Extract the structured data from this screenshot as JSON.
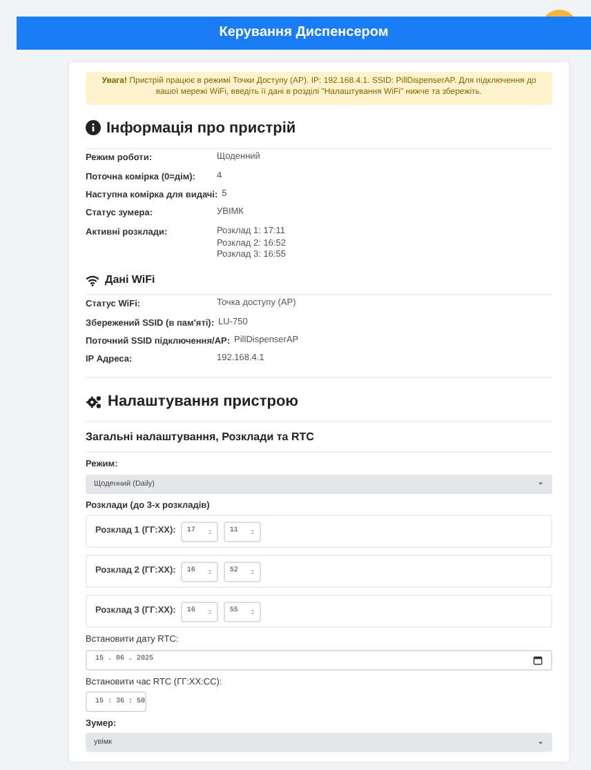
{
  "header": {
    "title": "Керування Диспенсером"
  },
  "alert": {
    "text": "**Увага!** Пристрій працює в режимі Точки Доступу (AP). IP: 192.168.4.1. SSID: PillDispenserAP. Для підключення до вашої мережі WiFi, введіть її дані в розділі \"Налаштування WiFi\" нижче та збережіть."
  },
  "info": {
    "title": "Інформація про пристрій",
    "rows": [
      {
        "label": "Режим роботи:",
        "lines": [
          "Щоденний"
        ]
      },
      {
        "label": "Поточна комірка (0=дім):",
        "lines": [
          "4"
        ]
      },
      {
        "label": "Наступна комірка для видачі:",
        "lines": [
          "5"
        ]
      },
      {
        "label": "Статус зумера:",
        "lines": [
          "УВІМК"
        ]
      },
      {
        "label": "Активні розклади:",
        "lines": [
          "Розклад 1: 17:11",
          "Розклад 2: 16:52",
          "Розклад 3: 16:55"
        ]
      }
    ]
  },
  "wifi": {
    "title": "Дані WiFi",
    "rows": [
      {
        "label": "Статус WiFi:",
        "lines": [
          "Точка доступу (AP)"
        ]
      },
      {
        "label": "Збережений SSID (в пам'яті):",
        "lines": [
          "LU-750"
        ]
      },
      {
        "label": "Поточний SSID підключення/AP:",
        "lines": [
          "PillDispenserAP"
        ]
      },
      {
        "label": "IP Адреса:",
        "lines": [
          "192.168.4.1"
        ]
      }
    ]
  },
  "settings": {
    "title": "Налаштування пристрою",
    "subtitle": "Загальні налаштування, Розклади та RTC",
    "mode": {
      "label": "Режим:",
      "value": "Щоденний (Daily)"
    },
    "schedules_label": "Розклади (до 3-х розкладів)",
    "schedules": [
      {
        "label": "Розклад 1 (ГГ:ХХ):",
        "hour": "17",
        "minute": "11"
      },
      {
        "label": "Розклад 2 (ГГ:ХХ):",
        "hour": "16",
        "minute": "52"
      },
      {
        "label": "Розклад 3 (ГГ:ХХ):",
        "hour": "16",
        "minute": "55"
      }
    ],
    "rtc_date": {
      "label": "Встановити дату RTC:",
      "value": "15 . 06 . 2025"
    },
    "rtc_time": {
      "label": "Встановити час RTC (ГГ:ХХ:СС):",
      "value": "15 : 36 : 50"
    },
    "buzzer": {
      "label": "Зумер:",
      "value": "увімк"
    }
  }
}
